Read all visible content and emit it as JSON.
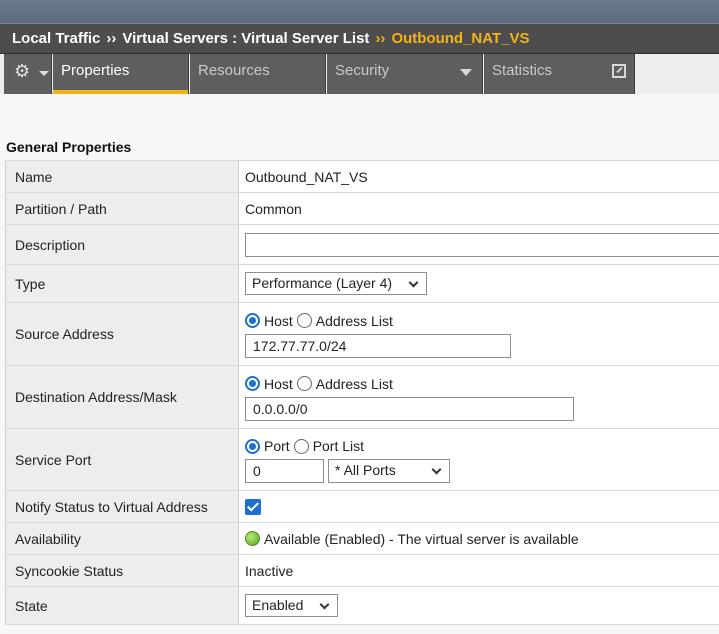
{
  "breadcrumb": {
    "items": [
      "Local Traffic",
      "Virtual Servers : Virtual Server List"
    ],
    "current": "Outbound_NAT_VS",
    "separator": "››"
  },
  "tabs": {
    "gear_icon": "gear-icon",
    "items": [
      {
        "label": "Properties",
        "active": true
      },
      {
        "label": "Resources",
        "active": false
      },
      {
        "label": "Security",
        "active": false,
        "has_dropdown": true
      },
      {
        "label": "Statistics",
        "active": false,
        "has_popout": true
      }
    ]
  },
  "section_title": "General Properties",
  "fields": {
    "name": {
      "label": "Name",
      "value": "Outbound_NAT_VS"
    },
    "partition": {
      "label": "Partition / Path",
      "value": "Common"
    },
    "description": {
      "label": "Description",
      "value": ""
    },
    "type": {
      "label": "Type",
      "value": "Performance (Layer 4)"
    },
    "source": {
      "label": "Source Address",
      "radio_host": "Host",
      "radio_list": "Address List",
      "value": "172.77.77.0/24"
    },
    "destination": {
      "label": "Destination Address/Mask",
      "radio_host": "Host",
      "radio_list": "Address List",
      "value": "0.0.0.0/0"
    },
    "service_port": {
      "label": "Service Port",
      "radio_port": "Port",
      "radio_list": "Port List",
      "value": "0",
      "select_value": "* All Ports"
    },
    "notify": {
      "label": "Notify Status to Virtual Address",
      "checked": true
    },
    "availability": {
      "label": "Availability",
      "value": "Available (Enabled) - The virtual server is available",
      "status_color": "#5aa51e"
    },
    "syncookie": {
      "label": "Syncookie Status",
      "value": "Inactive"
    },
    "state": {
      "label": "State",
      "value": "Enabled"
    }
  },
  "colors": {
    "accent": "#f4b21a",
    "control_blue": "#1a6fd1",
    "breadcrumb_bg": "#4d4d4d",
    "tab_bg": "#5e5e5e"
  }
}
